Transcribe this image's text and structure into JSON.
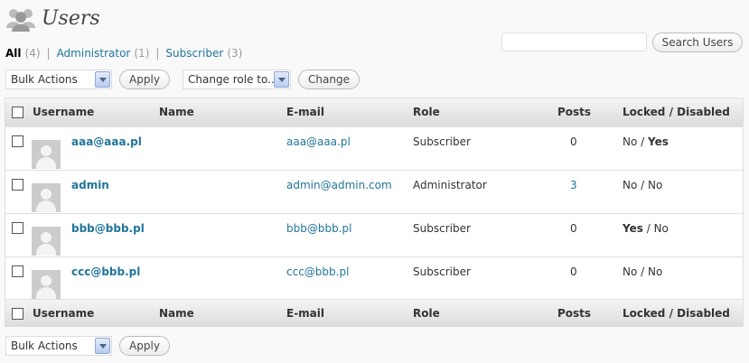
{
  "page": {
    "title": "Users"
  },
  "filters": [
    {
      "label": "All",
      "count": "(4)",
      "current": true
    },
    {
      "label": "Administrator",
      "count": "(1)",
      "current": false
    },
    {
      "label": "Subscriber",
      "count": "(3)",
      "current": false
    }
  ],
  "filter_separator": "|",
  "search": {
    "value": "",
    "placeholder": "",
    "button": "Search Users"
  },
  "top_actions": {
    "bulk_select": "Bulk Actions",
    "apply": "Apply",
    "role_select": "Change role to...",
    "change": "Change"
  },
  "bottom_actions": {
    "bulk_select": "Bulk Actions",
    "apply": "Apply"
  },
  "columns": {
    "username": "Username",
    "name": "Name",
    "email": "E-mail",
    "role": "Role",
    "posts": "Posts",
    "locked": "Locked / Disabled"
  },
  "rows": [
    {
      "username": "aaa@aaa.pl",
      "name": "",
      "email": "aaa@aaa.pl",
      "role": "Subscriber",
      "posts": "0",
      "locked": "No",
      "sep": "/",
      "disabled": "Yes",
      "locked_bold": false,
      "disabled_bold": true,
      "posts_link": false
    },
    {
      "username": "admin",
      "name": "",
      "email": "admin@admin.com",
      "role": "Administrator",
      "posts": "3",
      "locked": "No",
      "sep": "/",
      "disabled": "No",
      "locked_bold": false,
      "disabled_bold": false,
      "posts_link": true
    },
    {
      "username": "bbb@bbb.pl",
      "name": "",
      "email": "bbb@bbb.pl",
      "role": "Subscriber",
      "posts": "0",
      "locked": "Yes",
      "sep": "/",
      "disabled": "No",
      "locked_bold": true,
      "disabled_bold": false,
      "posts_link": false
    },
    {
      "username": "ccc@bbb.pl",
      "name": "",
      "email": "ccc@bbb.pl",
      "role": "Subscriber",
      "posts": "0",
      "locked": "No",
      "sep": "/",
      "disabled": "No",
      "locked_bold": false,
      "disabled_bold": false,
      "posts_link": false
    }
  ],
  "colors": {
    "link": "#21759b",
    "header_bg": "#dcdcdc",
    "page_bg": "#f9f9f9"
  }
}
